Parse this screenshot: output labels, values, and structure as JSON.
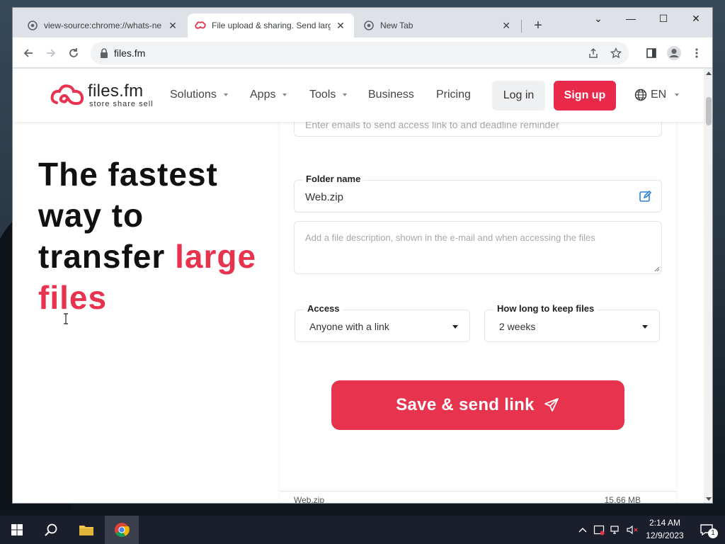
{
  "browser": {
    "tabs": [
      {
        "title": "view-source:chrome://whats-ne",
        "close": "✕"
      },
      {
        "title": "File upload & sharing. Send larg",
        "close": "✕"
      },
      {
        "title": "New Tab",
        "close": "✕"
      }
    ],
    "new_tab": "+",
    "window_controls": {
      "tab_search": "⌄",
      "minimize": "—",
      "maximize": "☐",
      "close": "✕"
    },
    "url": "files.fm"
  },
  "site": {
    "logo": {
      "name": "files.fm",
      "tagline": "store share sell"
    },
    "nav": [
      {
        "label": "Solutions",
        "has_dropdown": true
      },
      {
        "label": "Apps",
        "has_dropdown": true
      },
      {
        "label": "Tools",
        "has_dropdown": true
      },
      {
        "label": "Business",
        "has_dropdown": false
      },
      {
        "label": "Pricing",
        "has_dropdown": false
      }
    ],
    "login_label": "Log in",
    "signup_label": "Sign up",
    "language": "EN"
  },
  "hero": {
    "line1": "The fastest",
    "line2": "way to",
    "line3_plain": "transfer ",
    "line3_accent": "large",
    "line4_accent": "files"
  },
  "form": {
    "email_placeholder": "Enter emails to send access link to and deadline reminder",
    "folder_label": "Folder name",
    "folder_value": "Web.zip",
    "description_placeholder": "Add a file description, shown in the e-mail and when accessing the files",
    "access_label": "Access",
    "access_value": "Anyone with a link",
    "keep_label": "How long to keep files",
    "keep_value": "2 weeks",
    "save_label": "Save & send link"
  },
  "file_list": [
    {
      "name": "Web.zip",
      "size": "15.66 MB"
    }
  ],
  "taskbar": {
    "time": "2:14 AM",
    "date": "12/9/2023",
    "notification_count": "1"
  },
  "colors": {
    "brand_red": "#e8334f",
    "signup_red": "#e8294a",
    "taskbar": "#1a1f2b"
  }
}
